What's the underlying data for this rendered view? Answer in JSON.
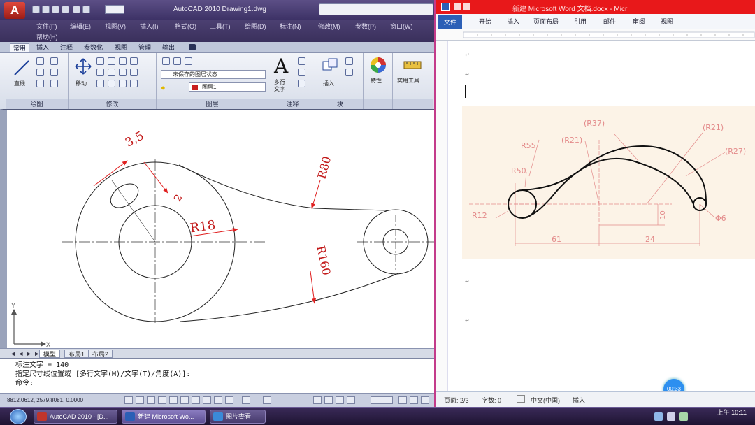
{
  "acad": {
    "logo": "A",
    "title": "AutoCAD 2010  Drawing1.dwg",
    "menus": [
      "文件(F)",
      "编辑(E)",
      "视图(V)",
      "插入(I)",
      "格式(O)",
      "工具(T)",
      "绘图(D)",
      "标注(N)",
      "修改(M)",
      "参数(P)",
      "窗口(W)"
    ],
    "submenu": "帮助(H)",
    "ribbon_tabs": [
      "常用",
      "插入",
      "注释",
      "参数化",
      "视图",
      "管理",
      "输出"
    ],
    "groups": {
      "draw": "绘图",
      "modify": "修改",
      "layer": "图层",
      "annotate": "注释",
      "block": "块",
      "props": "特性",
      "util": "实用工具"
    },
    "draw_btn": "直线",
    "modify_btn": "移动",
    "text_btn_line1": "多行",
    "text_btn_line2": "文字",
    "insert_btn": "插入",
    "props_btn": "特性",
    "util_btn": "实用工具",
    "layer_state": "未保存的图层状态",
    "layer_current": "图层1",
    "drawing": {
      "dim_35": "3,5",
      "dim_2": "2",
      "dim_r18": "R18",
      "dim_r80": "R80",
      "dim_r160": "R160"
    },
    "layout_tabs": [
      "模型",
      "布局1",
      "布局2"
    ],
    "cmd_lines": [
      "标注文字 = 140",
      "指定尺寸线位置或 [多行文字(M)/文字(T)/角度(A)]:",
      "命令:"
    ],
    "coords": "8812.0612, 2579.8081, 0.0000"
  },
  "word": {
    "title": "新建 Microsoft Word 文档.docx - Micr",
    "file_tab": "文件",
    "tabs": [
      "开始",
      "插入",
      "页面布局",
      "引用",
      "邮件",
      "审阅",
      "视图"
    ],
    "figure": {
      "r37": "(R37)",
      "r21a": "(R21)",
      "r21b": "(R21)",
      "r27": "(R27)",
      "r55": "R55",
      "r50": "R50",
      "r12": "R12",
      "d6": "Φ6",
      "d10": "10",
      "d61": "61",
      "d24": "24"
    },
    "status": {
      "page": "页面: 2/3",
      "words": "字数: 0",
      "lang": "中文(中国)",
      "mode": "插入"
    },
    "fab": "00:33"
  },
  "taskbar": {
    "tasks": [
      "AutoCAD 2010 - [D...",
      "新建 Microsoft Wo...",
      "图片查看"
    ],
    "clock_time": "10:11",
    "clock_label": "上午"
  },
  "colors": {
    "dim_red": "#e02020",
    "fig_red": "#e38a8a",
    "titlebar_red": "#e8181a"
  }
}
